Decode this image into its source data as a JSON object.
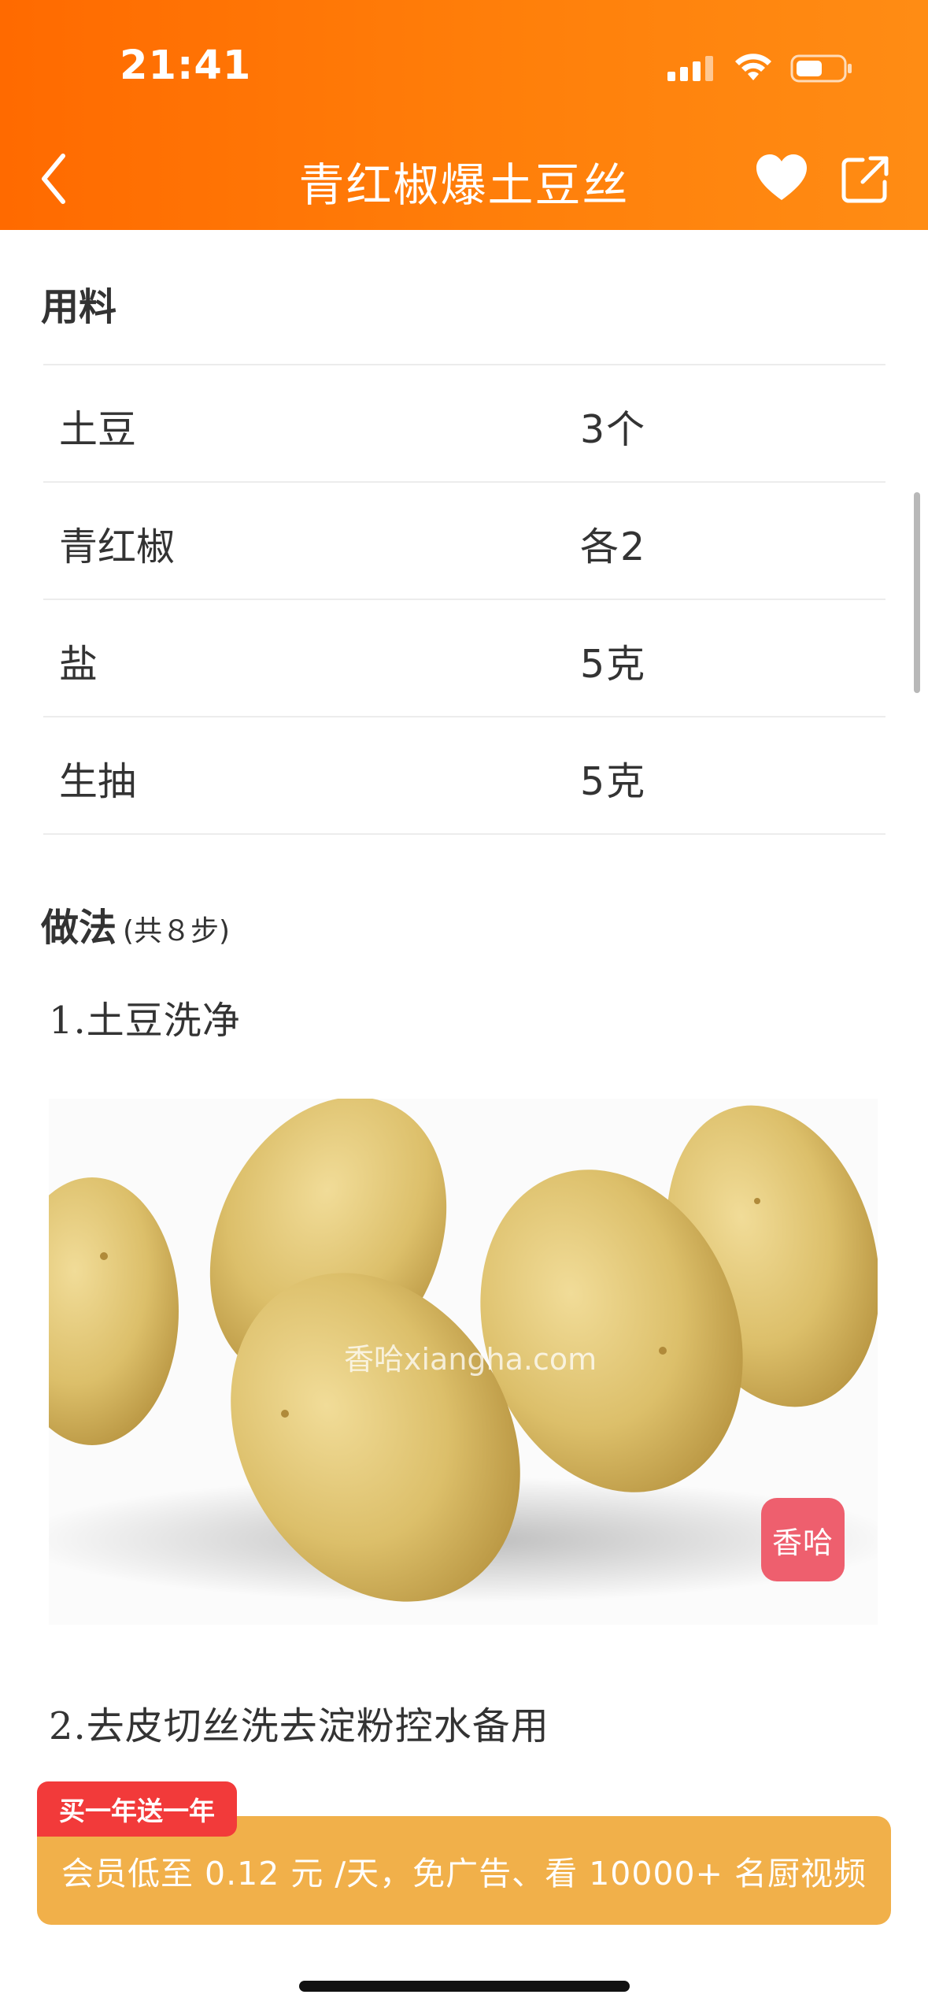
{
  "status_bar": {
    "time": "21:41"
  },
  "nav": {
    "title": "青红椒爆土豆丝"
  },
  "ingredients": {
    "title": "用料",
    "items": [
      {
        "name": "土豆",
        "amount": "3个"
      },
      {
        "name": "青红椒",
        "amount": "各2"
      },
      {
        "name": "盐",
        "amount": "5克"
      },
      {
        "name": "生抽",
        "amount": "5克"
      }
    ]
  },
  "steps": {
    "title": "做法",
    "count_label": "(共８步)",
    "items": [
      {
        "text": "1.土豆洗净"
      },
      {
        "text": "2.去皮切丝洗去淀粉控水备用"
      }
    ],
    "image": {
      "watermark": "香哈xiangha.com",
      "logo": "香哈"
    }
  },
  "promo": {
    "tag": "买一年送一年",
    "text": "会员低至 0.12 元 /天，免广告、看 10000+ 名厨视频"
  },
  "colors": {
    "header_start": "#ff6a00",
    "header_end": "#ff8c14",
    "promo_bg": "#f1b04a",
    "promo_tag": "#f23a3a"
  }
}
